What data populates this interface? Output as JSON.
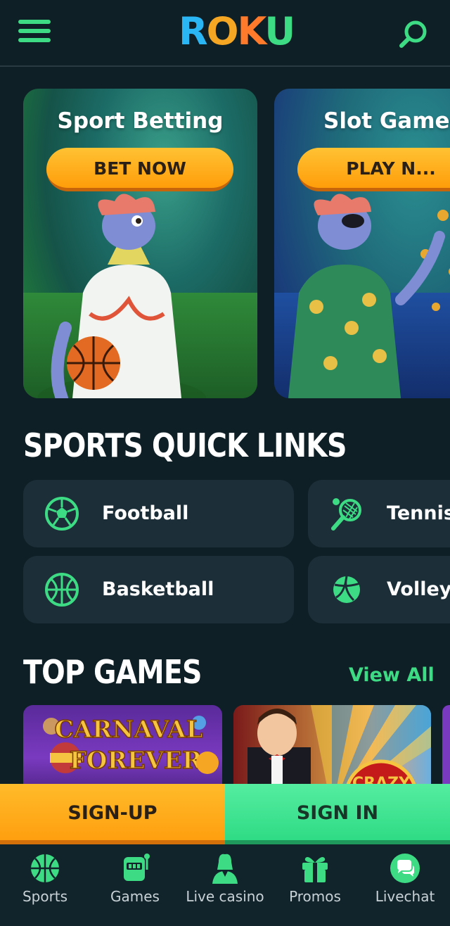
{
  "header": {
    "logo_letters": [
      "R",
      "O",
      "K",
      "U"
    ],
    "menu_icon": "hamburger-icon",
    "search_icon": "search-icon"
  },
  "promos": [
    {
      "title": "Sport Betting",
      "button": "BET NOW"
    },
    {
      "title": "Slot Games",
      "button": "PLAY N..."
    }
  ],
  "quick_links": {
    "title": "SPORTS QUICK LINKS",
    "items": [
      {
        "label": "Football",
        "icon": "football-icon"
      },
      {
        "label": "Tennis",
        "icon": "tennis-racket-icon"
      },
      {
        "label": "Basketball",
        "icon": "basketball-icon"
      },
      {
        "label": "Volley",
        "icon": "volleyball-icon"
      }
    ]
  },
  "top_games": {
    "title": "TOP GAMES",
    "view_all": "View All",
    "games": [
      {
        "art_text_1": "CARNAVAL",
        "art_text_2": "FOREVER"
      },
      {
        "art_text_1": "CRAZY"
      }
    ]
  },
  "auth": {
    "signup": "SIGN-UP",
    "signin": "SIGN IN"
  },
  "bottom_nav": [
    {
      "label": "Sports",
      "icon": "basketball-icon"
    },
    {
      "label": "Games",
      "icon": "slot-machine-icon"
    },
    {
      "label": "Live casino",
      "icon": "dealer-icon"
    },
    {
      "label": "Promos",
      "icon": "gift-icon"
    },
    {
      "label": "Livechat",
      "icon": "chat-icon"
    }
  ],
  "colors": {
    "background": "#0f1f26",
    "accent_green": "#3ddc84",
    "accent_orange": "#ffa514",
    "card": "#1c2e38"
  }
}
